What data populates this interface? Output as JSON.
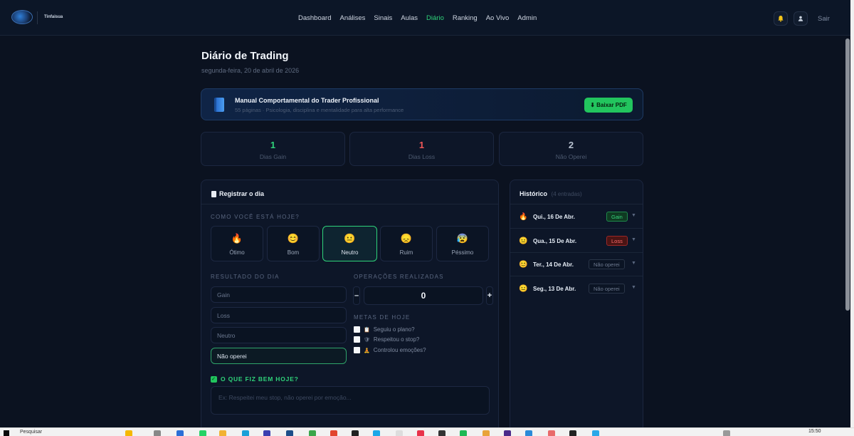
{
  "header": {
    "brand": "Tinfaisua",
    "nav": [
      "Dashboard",
      "Análises",
      "Sinais",
      "Aulas",
      "Diário",
      "Ranking",
      "Ao Vivo",
      "Admin"
    ],
    "active_nav": "Diário",
    "logout_label": "Sair",
    "icons": [
      "bell-icon",
      "user-icon"
    ]
  },
  "page": {
    "title": "Diário de Trading",
    "date": "segunda-feira, 20 de abril de 2026"
  },
  "manual": {
    "title": "Manual Comportamental do Trader Profissional",
    "subtitle": "55 páginas · Psicologia, disciplina e mentalidade para alta performance",
    "button": "⬇ Baixar PDF",
    "icon": "book-icon"
  },
  "stats": [
    {
      "value": "1",
      "label": "Dias Gain",
      "color": "#2fd37a"
    },
    {
      "value": "1",
      "label": "Dias Loss",
      "color": "#f05757"
    },
    {
      "value": "2",
      "label": "Não Operei",
      "color": "#b8c2d0"
    }
  ],
  "register": {
    "title": "Registrar o dia",
    "mood_label": "COMO VOCÊ ESTÁ HOJE?",
    "moods": [
      {
        "emoji": "🔥",
        "label": "Ótimo"
      },
      {
        "emoji": "😊",
        "label": "Bom"
      },
      {
        "emoji": "😐",
        "label": "Neutro"
      },
      {
        "emoji": "😞",
        "label": "Ruim"
      },
      {
        "emoji": "😰",
        "label": "Péssimo"
      }
    ],
    "selected_mood": "Neutro",
    "result_label": "RESULTADO DO DIA",
    "results": [
      "Gain",
      "Loss",
      "Neutro",
      "Não operei"
    ],
    "selected_result": "Não operei",
    "ops_label": "OPERAÇÕES REALIZADAS",
    "ops_minus": "–",
    "ops_value": "0",
    "ops_plus": "+",
    "goals_label": "METAS DE HOJE",
    "goals": [
      {
        "icon": "📋",
        "label": "Seguiu o plano?"
      },
      {
        "icon": "🛡",
        "label": "Respeitou o stop?"
      },
      {
        "icon": "🧘",
        "label": "Controlou emoções?"
      }
    ],
    "fiz_label": "O QUE FIZ BEM HOJE?",
    "fiz_check": "✓",
    "fiz_placeholder": "Ex: Respeitei meu stop, não operei por emoção..."
  },
  "history": {
    "title": "Histórico",
    "count": "(4 entradas)",
    "entries": [
      {
        "emoji": "🔥",
        "date": "Qui., 16 De Abr.",
        "status": "Gain",
        "caret": "▼"
      },
      {
        "emoji": "😐",
        "date": "Qua., 15 De Abr.",
        "status": "Loss",
        "caret": "▼"
      },
      {
        "emoji": "😊",
        "date": "Ter., 14 De Abr.",
        "status": "Não operei",
        "caret": "▼"
      },
      {
        "emoji": "😐",
        "date": "Seg., 13 De Abr.",
        "status": "Não operei",
        "caret": "▼"
      }
    ]
  },
  "taskbar": {
    "search": "Pesquisar",
    "clock": "15:50"
  }
}
